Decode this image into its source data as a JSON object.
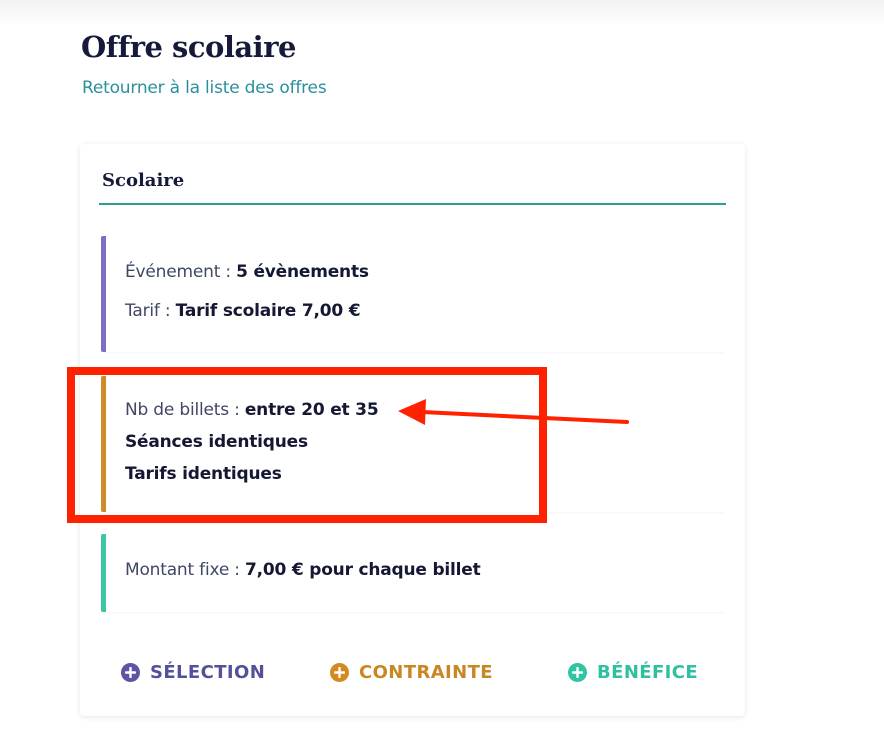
{
  "header": {
    "title": "Offre scolaire",
    "back_link": "Retourner à la liste des offres"
  },
  "card": {
    "title": "Scolaire",
    "selection_block": {
      "event_label": "Événement : ",
      "event_value": "5 évènements",
      "tarif_label": "Tarif : ",
      "tarif_value": "Tarif scolaire 7,00 €"
    },
    "constraint_block": {
      "tickets_label": "Nb de billets : ",
      "tickets_value": "entre 20 et 35",
      "line2": "Séances identiques",
      "line3": "Tarifs identiques"
    },
    "benefit_block": {
      "amount_label": "Montant fixe : ",
      "amount_value": "7,00 € pour chaque billet"
    },
    "actions": {
      "selection": "SÉLECTION",
      "constraint": "CONTRAINTE",
      "benefit": "BÉNÉFICE"
    }
  },
  "icons": {
    "add_selection": "plus-circle-icon",
    "add_constraint": "plus-circle-icon",
    "add_benefit": "plus-circle-icon",
    "annotation": "arrow-left-icon"
  },
  "colors": {
    "selection": "#5b55a3",
    "constraint": "#d48a1f",
    "benefit": "#2fc5a3",
    "link": "#2a8f9c",
    "annotation": "#ff2200"
  }
}
